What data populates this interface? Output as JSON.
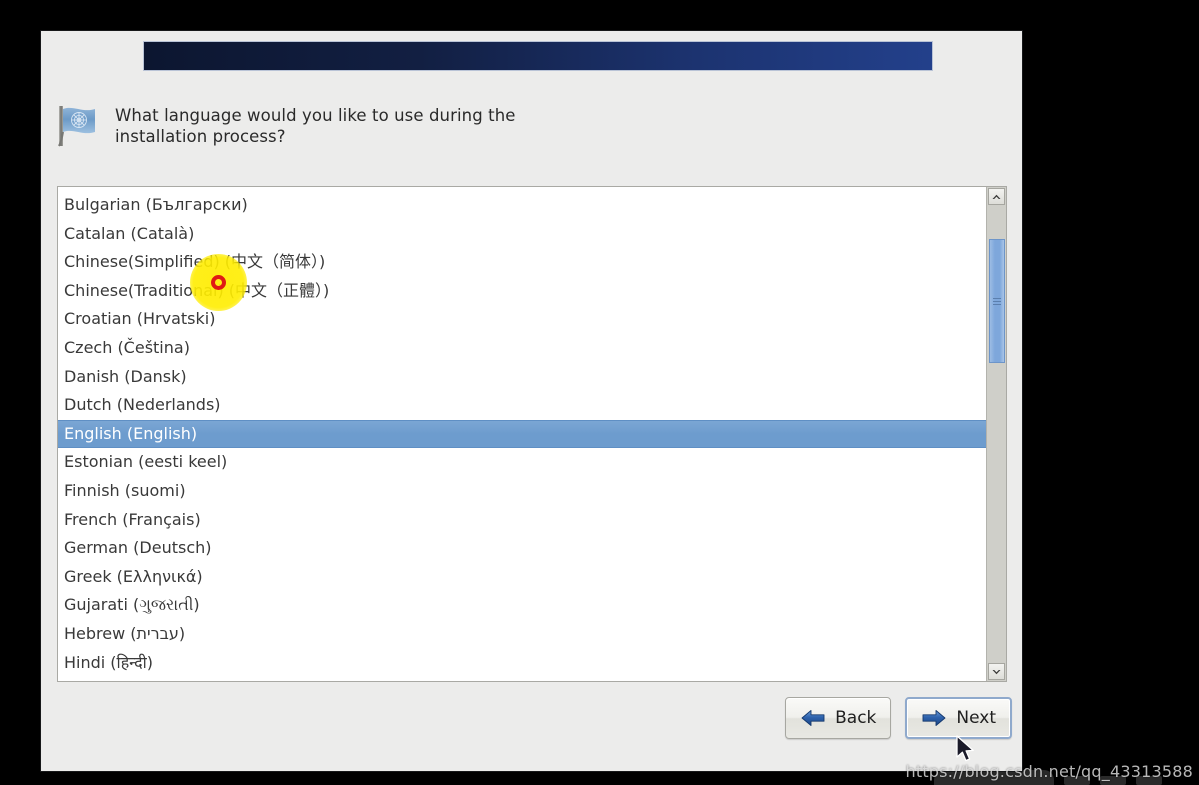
{
  "dialog": {
    "question": "What language would you like to use during the\ninstallation process?",
    "flag_icon": "un-flag-icon"
  },
  "language_list": {
    "items": [
      {
        "label": "Bulgarian (Български)",
        "selected": false
      },
      {
        "label": "Catalan (Català)",
        "selected": false
      },
      {
        "label": "Chinese(Simplified) (中文（简体）)",
        "selected": false
      },
      {
        "label": "Chinese(Traditional) (中文（正體）)",
        "selected": false
      },
      {
        "label": "Croatian (Hrvatski)",
        "selected": false
      },
      {
        "label": "Czech (Čeština)",
        "selected": false
      },
      {
        "label": "Danish (Dansk)",
        "selected": false
      },
      {
        "label": "Dutch (Nederlands)",
        "selected": false
      },
      {
        "label": "English (English)",
        "selected": true
      },
      {
        "label": "Estonian (eesti keel)",
        "selected": false
      },
      {
        "label": "Finnish (suomi)",
        "selected": false
      },
      {
        "label": "French (Français)",
        "selected": false
      },
      {
        "label": "German (Deutsch)",
        "selected": false
      },
      {
        "label": "Greek (Ελληνικά)",
        "selected": false
      },
      {
        "label": "Gujarati (ગુજરાતી)",
        "selected": false
      },
      {
        "label": "Hebrew (עברית)",
        "selected": false
      },
      {
        "label": "Hindi (हिन्दी)",
        "selected": false
      }
    ],
    "selected_value": "English (English)"
  },
  "scrollbar": {
    "up_icon": "chevron-up-icon",
    "down_icon": "chevron-down-icon",
    "thumb_grip_icon": "grip-lines-icon"
  },
  "buttons": {
    "back": {
      "label": "Back",
      "icon": "arrow-left-icon",
      "focused": false
    },
    "next": {
      "label": "Next",
      "icon": "arrow-right-icon",
      "focused": true
    }
  },
  "overlay": {
    "click_marker": "click-target-marker",
    "cursor": "mouse-pointer-icon"
  },
  "watermark": {
    "text": "https://blog.csdn.net/qq_43313588"
  },
  "colors": {
    "banner_dark": "#0c1630",
    "banner_light": "#23408b",
    "selection_blue": "#6d9cce",
    "scrollbar_thumb": "#7ea7db",
    "dialog_bg": "#ececeb",
    "highlight_yellow": "#ffed00",
    "marker_red": "#e01b14"
  }
}
